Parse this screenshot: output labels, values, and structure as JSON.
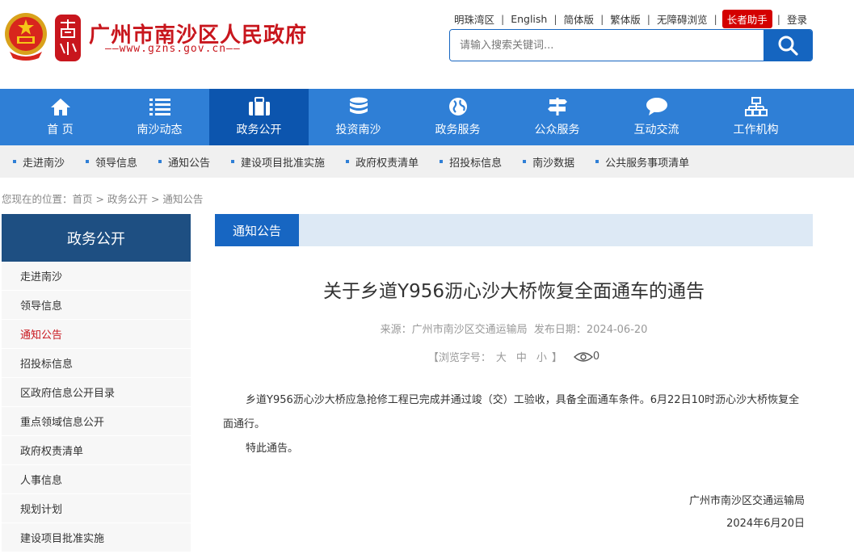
{
  "header": {
    "site_title": "广州市南沙区人民政府",
    "site_url": "——www.gzns.gov.cn——",
    "top_links": {
      "mingzhu": "明珠湾区",
      "english": "English",
      "simplified": "简体版",
      "traditional": "繁体版",
      "accessible": "无障碍浏览",
      "elder": "长者助手",
      "login": "登录"
    },
    "search_placeholder": "请输入搜索关键词..."
  },
  "main_nav": [
    {
      "label": "首 页",
      "icon": "home-icon"
    },
    {
      "label": "南沙动态",
      "icon": "list-icon"
    },
    {
      "label": "政务公开",
      "icon": "briefcase-icon"
    },
    {
      "label": "投资南沙",
      "icon": "coins-icon"
    },
    {
      "label": "政务服务",
      "icon": "globe-icon"
    },
    {
      "label": "公众服务",
      "icon": "signpost-icon"
    },
    {
      "label": "互动交流",
      "icon": "chat-icon"
    },
    {
      "label": "工作机构",
      "icon": "org-chart-icon"
    }
  ],
  "sub_nav": [
    "走进南沙",
    "领导信息",
    "通知公告",
    "建设项目批准实施",
    "政府权责清单",
    "招投标信息",
    "南沙数据",
    "公共服务事项清单"
  ],
  "breadcrumb": {
    "prefix": "您现在的位置：",
    "home": "首页",
    "sep": " > ",
    "level1": "政务公开",
    "level2": "通知公告"
  },
  "sidebar": {
    "title": "政务公开",
    "items": [
      "走进南沙",
      "领导信息",
      "通知公告",
      "招投标信息",
      "区政府信息公开目录",
      "重点领域信息公开",
      "政府权责清单",
      "人事信息",
      "规划计划",
      "建设项目批准实施"
    ]
  },
  "content": {
    "column_title": "通知公告",
    "article_title": "关于乡道Y956沥心沙大桥恢复全面通车的通告",
    "source_label": "来源：",
    "source": "广州市南沙区交通运输局",
    "date_label": "发布日期：",
    "date": "2024-06-20",
    "font_label": "【浏览字号：",
    "font_large": "大",
    "font_medium": "中",
    "font_small": "小",
    "font_close": "】",
    "views": "0",
    "paragraph1": "乡道Y956沥心沙大桥应急抢修工程已完成并通过竣（交）工验收，具备全面通车条件。6月22日10时沥心沙大桥恢复全面通行。",
    "paragraph2": "特此通告。",
    "sign_org": "广州市南沙区交通运输局",
    "sign_date": "2024年6月20日"
  },
  "colors": {
    "brand_red": "#c8161d",
    "nav_blue": "#2f7fd6",
    "nav_active": "#0c55ae",
    "sidebar_head": "#1e4f82",
    "column_tab": "#1766c2"
  }
}
